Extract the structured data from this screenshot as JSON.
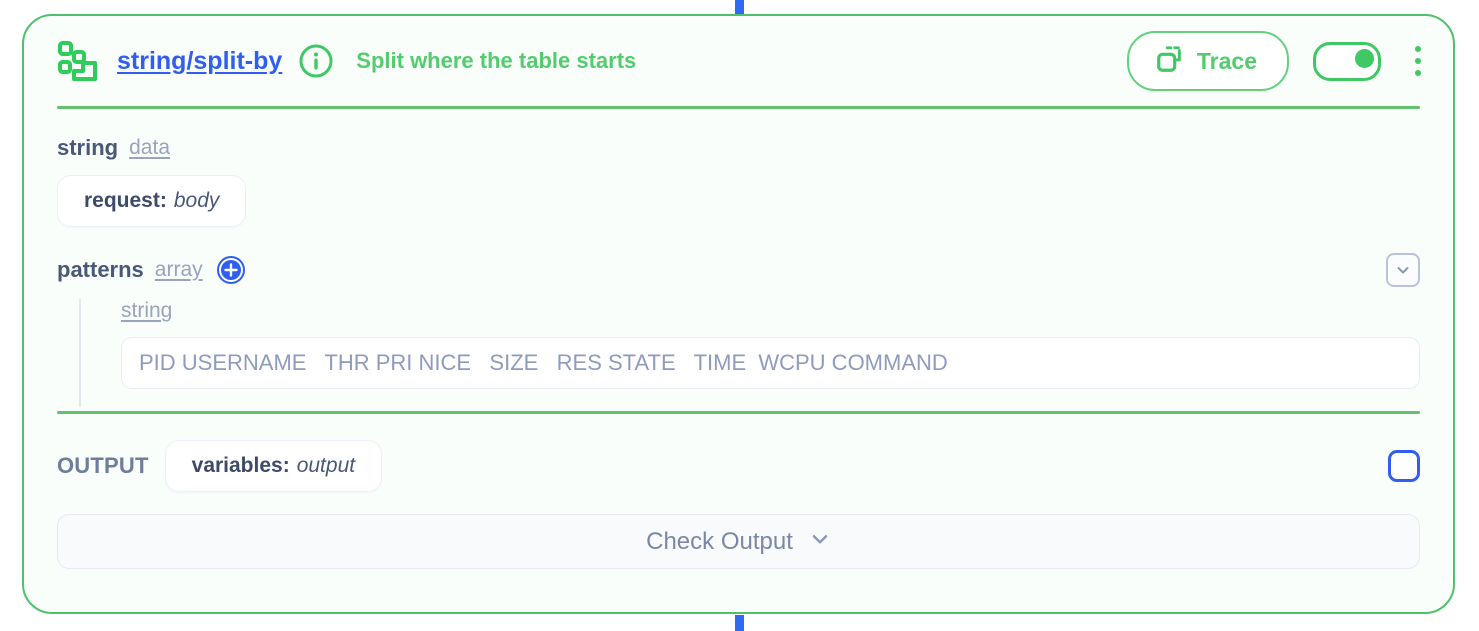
{
  "node": {
    "logo_icon": "split-blocks-icon",
    "link_label": "string/split-by",
    "info_icon": "info-circle-icon",
    "title": "Split where the table starts",
    "trace_label": "Trace",
    "trace_icon": "copy-trace-icon",
    "toggle_state": "on",
    "menu_icon": "kebab-menu-icon",
    "accent_green": "#4ec16a",
    "link_blue": "#2f5ef0"
  },
  "fields": {
    "data": {
      "name": "string",
      "type": "data",
      "value_key": "request:",
      "value": "body"
    },
    "patterns": {
      "name": "patterns",
      "type": "array",
      "add_icon": "plus-circle-icon",
      "collapse_icon": "chevron-down-icon",
      "items": [
        {
          "type": "string",
          "value": "PID USERNAME   THR PRI NICE   SIZE   RES STATE   TIME  WCPU COMMAND"
        }
      ]
    }
  },
  "output": {
    "label": "OUTPUT",
    "value_key": "variables:",
    "value": "output",
    "checkbox_checked": false,
    "check_output_label": "Check Output",
    "check_output_icon": "chevron-down-icon"
  }
}
